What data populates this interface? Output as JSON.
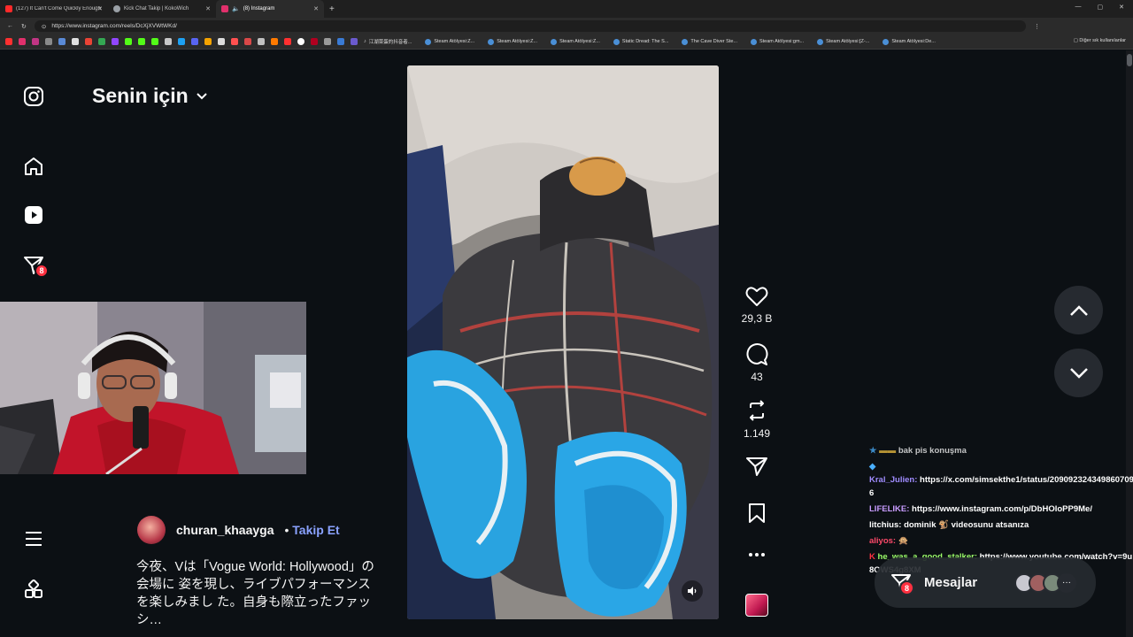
{
  "browser": {
    "tabs": [
      {
        "title": "(127) It Can't Come Quickly Enough",
        "color": "#ff2a2a"
      },
      {
        "title": "Kick Chat Takip | KokoWich",
        "color": "#9aa0a6"
      },
      {
        "title": "(8) Instagram",
        "color": "#e1306c"
      }
    ],
    "new_tab": "+",
    "url": "https://www.instagram.com/reels/DcXjXVWtWKd/",
    "bookmarks": [
      {
        "label": "江湖菜蛋的抖音者..."
      },
      {
        "label": "Steam Atölyesi:Z..."
      },
      {
        "label": "Steam Atölyesi:Z..."
      },
      {
        "label": "Steam Atölyesi:Z..."
      },
      {
        "label": "Static Dread: The S..."
      },
      {
        "label": "The Cave Diver Ste..."
      },
      {
        "label": "Steam Atölyesi:gm..."
      },
      {
        "label": "Steam Atölyesi:[Z-..."
      },
      {
        "label": "Steam Atölyesi:De..."
      }
    ],
    "other_bookmarks": "Diğer sık kullanılanlar"
  },
  "sidebar": {
    "notifications_count": "8",
    "icons": [
      "instagram-logo-icon",
      "home-icon",
      "reels-icon",
      "messages-icon",
      "menu-icon",
      "more-apps-icon"
    ]
  },
  "feed": {
    "title": "Senin için"
  },
  "post": {
    "author": "churan_khaayga",
    "separator": "•",
    "follow": "Takip Et",
    "caption": "今夜、Vは「Vogue World: Hollywood」の会場に 姿を現し、ライブパフォーマンスを楽しみまし た。自身も際立ったファッシ…",
    "likes": "29,3 B",
    "comments": "43",
    "reposts": "1.149"
  },
  "chat": [
    {
      "user": "",
      "text": "bak pis konuşma",
      "userColor": "#a08cff"
    },
    {
      "user": "Kral_Julien:",
      "text": "https://x.com/simsekthe1/status/2090923243498607096",
      "userColor": "#a08cff"
    },
    {
      "user": "LIFELIKE:",
      "text": "https://www.instagram.com/p/DbHOloPP9Me/",
      "userColor": "#c89cff"
    },
    {
      "user": "litchius:",
      "text": "dominik 🐒 videosunu atsanıza",
      "userColor": "#ffffff"
    },
    {
      "user": "aliyos:",
      "text": "🙊",
      "userColor": "#ff4a6a"
    },
    {
      "user": "he_was_a_good_stalker:",
      "text": "https://www.youtube.com/watch?v=9u8OWS4g8XM",
      "userColor": "#9cff6a"
    }
  ],
  "messages": {
    "label": "Mesajlar",
    "count": "8"
  },
  "colors": {
    "background": "#0c1014",
    "badge": "#ff3040",
    "follow": "#8aa2ff"
  }
}
